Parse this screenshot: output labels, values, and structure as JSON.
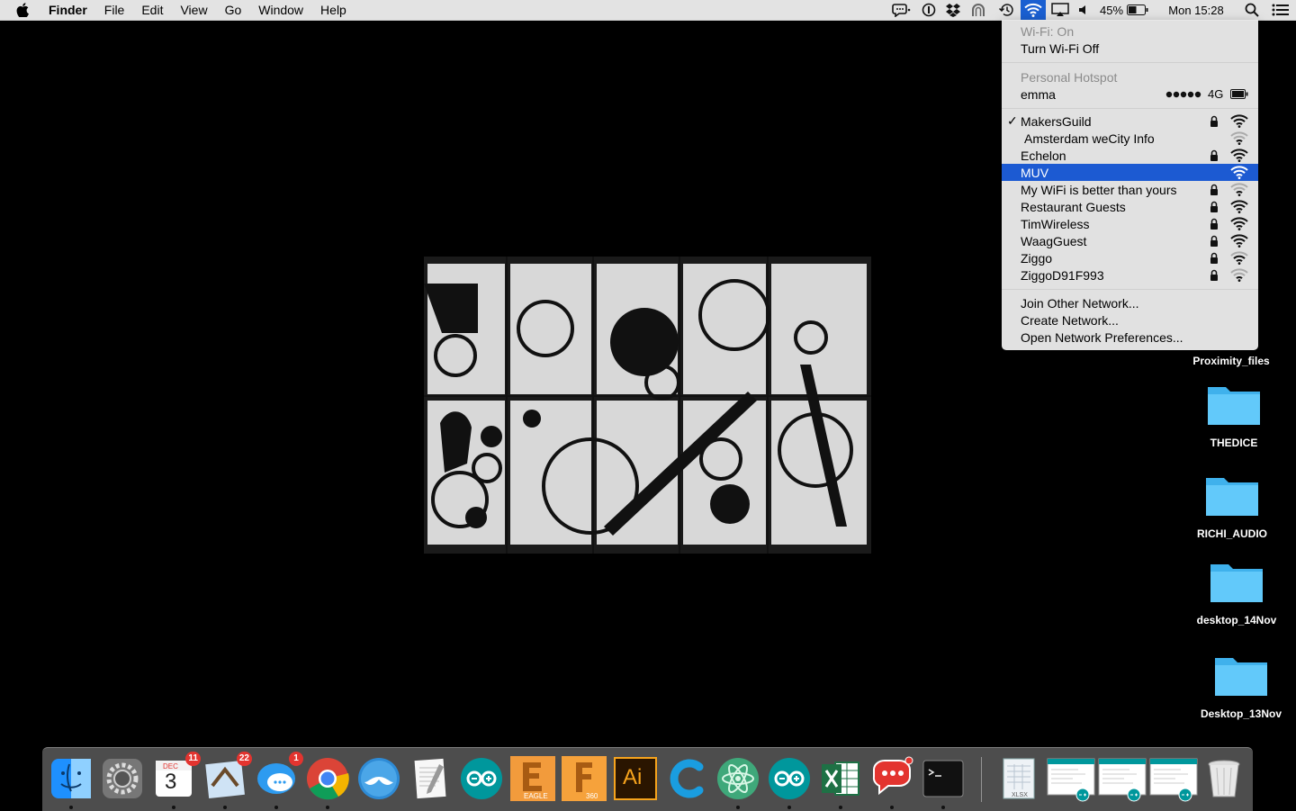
{
  "menubar": {
    "app_name": "Finder",
    "menus": [
      "File",
      "Edit",
      "View",
      "Go",
      "Window",
      "Help"
    ],
    "battery_percent": "45%",
    "clock": "Mon 15:28"
  },
  "wifi_menu": {
    "status": "Wi-Fi: On",
    "toggle_label": "Turn Wi-Fi Off",
    "hotspot_header": "Personal Hotspot",
    "hotspot_name": "emma",
    "hotspot_network_type": "4G",
    "networks": [
      {
        "name": "MakersGuild",
        "connected": true,
        "locked": true,
        "strength": 3
      },
      {
        "name": "Amsterdam weCity Info",
        "connected": false,
        "locked": false,
        "strength": 1
      },
      {
        "name": "Echelon",
        "connected": false,
        "locked": true,
        "strength": 3
      },
      {
        "name": "MUV",
        "connected": false,
        "locked": false,
        "strength": 3,
        "highlighted": true
      },
      {
        "name": "My WiFi is better than yours",
        "connected": false,
        "locked": true,
        "strength": 1
      },
      {
        "name": "Restaurant Guests",
        "connected": false,
        "locked": true,
        "strength": 3
      },
      {
        "name": "TimWireless",
        "connected": false,
        "locked": true,
        "strength": 3
      },
      {
        "name": "WaagGuest",
        "connected": false,
        "locked": true,
        "strength": 3
      },
      {
        "name": "Ziggo",
        "connected": false,
        "locked": true,
        "strength": 2
      },
      {
        "name": "ZiggoD91F993",
        "connected": false,
        "locked": true,
        "strength": 1
      }
    ],
    "actions": [
      "Join Other Network...",
      "Create Network...",
      "Open Network Preferences..."
    ]
  },
  "desktop": {
    "items": [
      "Proximity_files",
      "THEDICE",
      "RICHI_AUDIO",
      "desktop_14Nov",
      "Desktop_13Nov"
    ]
  },
  "dock": {
    "apps": [
      {
        "name": "Finder",
        "icon": "finder-icon",
        "running": true
      },
      {
        "name": "System Preferences",
        "icon": "gear-icon",
        "running": false
      },
      {
        "name": "Calendar",
        "icon": "calendar-icon",
        "running": true,
        "badge": "11",
        "month": "DEC",
        "day": "3"
      },
      {
        "name": "Mail",
        "icon": "mail-icon",
        "running": true,
        "badge": "22"
      },
      {
        "name": "Messages",
        "icon": "messages-icon",
        "running": true,
        "badge": "1"
      },
      {
        "name": "Chrome",
        "icon": "chrome-icon",
        "running": true
      },
      {
        "name": "Mustache app",
        "icon": "mustache-icon",
        "running": false
      },
      {
        "name": "TextEdit",
        "icon": "textedit-icon",
        "running": false
      },
      {
        "name": "Arduino",
        "icon": "arduino-icon",
        "running": false
      },
      {
        "name": "EAGLE",
        "icon": "eagle-icon",
        "running": false,
        "caption": "EAGLE"
      },
      {
        "name": "Fusion 360",
        "icon": "fusion-icon",
        "running": false,
        "caption": "360"
      },
      {
        "name": "Illustrator",
        "icon": "illustrator-icon",
        "running": false,
        "caption": "Ai"
      },
      {
        "name": "C app",
        "icon": "c-icon",
        "running": false
      },
      {
        "name": "Atom",
        "icon": "atom-icon",
        "running": true
      },
      {
        "name": "Arduino 2",
        "icon": "arduino-icon",
        "running": true
      },
      {
        "name": "Excel",
        "icon": "excel-icon",
        "running": true
      },
      {
        "name": "Speech bubble app",
        "icon": "chat-icon",
        "running": true
      },
      {
        "name": "Terminal",
        "icon": "terminal-icon",
        "running": true
      }
    ],
    "stacks": [
      {
        "name": "XLSX file",
        "icon": "spreadsheet-file-icon",
        "caption": "XLSX"
      },
      {
        "name": "Arduino window 1",
        "icon": "arduino-window-icon"
      },
      {
        "name": "Arduino window 2",
        "icon": "arduino-window-icon"
      },
      {
        "name": "Arduino window 3",
        "icon": "arduino-window-icon"
      },
      {
        "name": "Trash",
        "icon": "trash-icon"
      }
    ]
  }
}
